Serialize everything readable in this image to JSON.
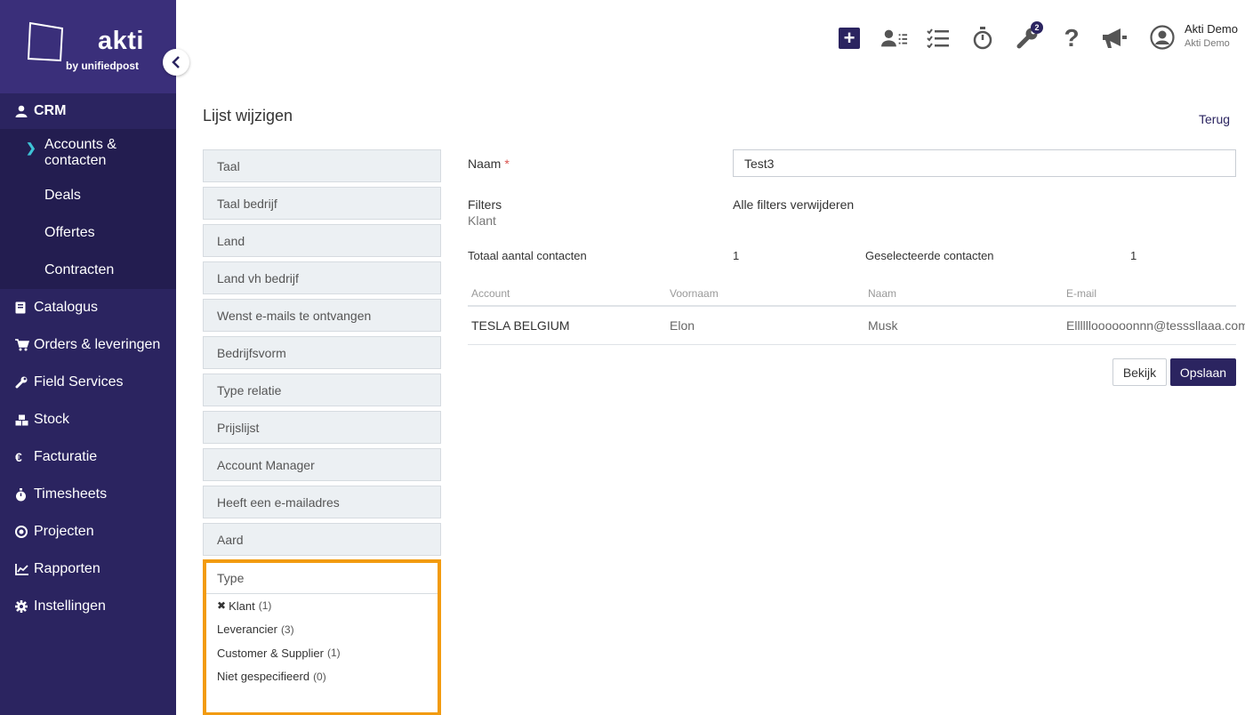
{
  "brand": {
    "name": "akti",
    "tagline": "by unifiedpost"
  },
  "sidebar": {
    "crm_label": "CRM",
    "crm_sub": [
      {
        "label": "Accounts & contacten",
        "active": true
      },
      {
        "label": "Deals"
      },
      {
        "label": "Offertes"
      },
      {
        "label": "Contracten"
      }
    ],
    "items": [
      {
        "label": "Catalogus",
        "icon": "book-icon"
      },
      {
        "label": "Orders & leveringen",
        "icon": "cart-icon"
      },
      {
        "label": "Field Services",
        "icon": "wrench-icon"
      },
      {
        "label": "Stock",
        "icon": "cubes-icon"
      },
      {
        "label": "Facturatie",
        "icon": "euro-icon"
      },
      {
        "label": "Timesheets",
        "icon": "stopwatch-icon"
      },
      {
        "label": "Projecten",
        "icon": "target-icon"
      },
      {
        "label": "Rapporten",
        "icon": "chart-icon"
      },
      {
        "label": "Instellingen",
        "icon": "gear-icon"
      }
    ]
  },
  "topbar": {
    "notification_count": "2",
    "user_name": "Akti Demo",
    "user_company": "Akti Demo"
  },
  "page": {
    "title": "Lijst wijzigen",
    "back_label": "Terug"
  },
  "filters": {
    "items": [
      "Taal",
      "Taal bedrijf",
      "Land",
      "Land vh bedrijf",
      "Wenst e-mails te ontvangen",
      "Bedrijfsvorm",
      "Type relatie",
      "Prijslijst",
      "Account Manager",
      "Heeft een e-mailadres",
      "Aard"
    ],
    "open": {
      "title": "Type",
      "options": [
        {
          "label": "Klant",
          "count": "(1)",
          "selected": true
        },
        {
          "label": "Leverancier",
          "count": "(3)"
        },
        {
          "label": "Customer & Supplier",
          "count": "(1)"
        },
        {
          "label": "Niet gespecifieerd",
          "count": "(0)"
        }
      ]
    }
  },
  "form": {
    "name_label": "Naam",
    "name_required": "*",
    "name_value": "Test3",
    "filters_label": "Filters",
    "active_filter": "Klant",
    "remove_filters": "Alle filters verwijderen",
    "total_label": "Totaal aantal contacten",
    "total_value": "1",
    "selected_label": "Geselecteerde contacten",
    "selected_value": "1"
  },
  "table": {
    "columns": [
      "Account",
      "Voornaam",
      "Naam",
      "E-mail"
    ],
    "rows": [
      [
        "TESLA BELGIUM",
        "Elon",
        "Musk",
        "Elllllloooooonnn@tesssllaaa.com"
      ]
    ]
  },
  "actions": {
    "view_label": "Bekijk",
    "save_label": "Opslaan"
  }
}
